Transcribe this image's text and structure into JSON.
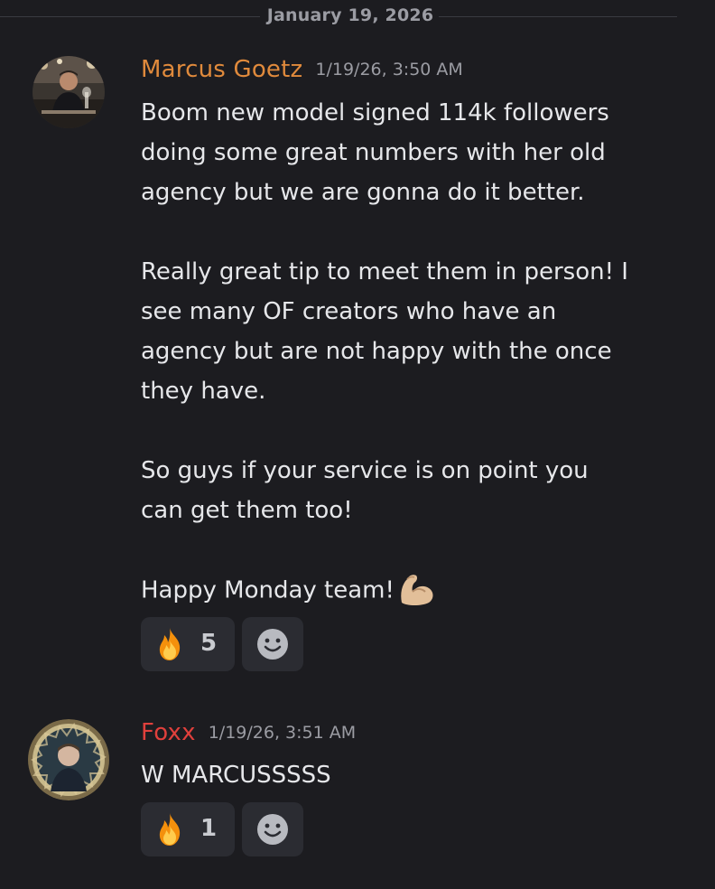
{
  "date_divider": {
    "label": "January 19, 2026"
  },
  "messages": [
    {
      "username": "Marcus Goetz",
      "username_color": "#e08a3c",
      "timestamp": "1/19/26, 3:50 AM",
      "paragraphs": [
        [
          "Boom new model signed 114k followers",
          "doing some great numbers with her old",
          "agency but we are gonna do it better."
        ],
        [
          "Really great tip to meet them in person! I",
          "see many OF creators who have an",
          "agency but are not happy with the once",
          "they have."
        ],
        [
          "So guys if your service is on point you",
          "can get them too!"
        ],
        [
          "Happy Monday team!"
        ]
      ],
      "trailing_emoji": "flexed-biceps-emoji",
      "reaction": {
        "emoji": "fire-emoji",
        "count": "5"
      },
      "add_reaction_icon": "smiley-icon"
    },
    {
      "username": "Foxx",
      "username_color": "#e0403c",
      "timestamp": "1/19/26, 3:51 AM",
      "paragraphs": [
        [
          "W MARCUSSSSS"
        ]
      ],
      "reaction": {
        "emoji": "fire-emoji",
        "count": "1"
      },
      "add_reaction_icon": "smiley-icon"
    }
  ]
}
